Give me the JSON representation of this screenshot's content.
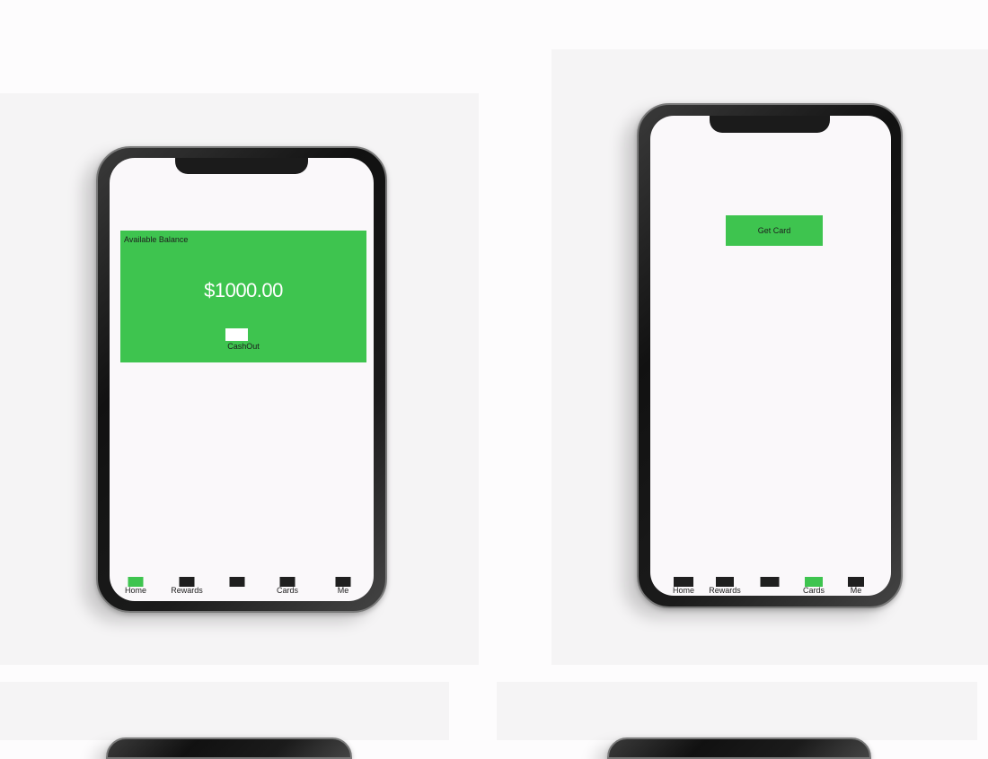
{
  "colors": {
    "accent_green": "#3ec44f",
    "nav_inactive": "#1f1f1f",
    "screen_bg": "#faf8fa"
  },
  "home_screen": {
    "balance_label": "Available Balance",
    "balance_amount": "$1000.00",
    "cashout_label": "CashOut",
    "nav": [
      {
        "label": "Home",
        "icon": "home-icon",
        "active": true
      },
      {
        "label": "Rewards",
        "icon": "rewards-icon",
        "active": false
      },
      {
        "label": "",
        "icon": "nav-icon",
        "active": false
      },
      {
        "label": "Cards",
        "icon": "cards-icon",
        "active": false
      },
      {
        "label": "Me",
        "icon": "profile-icon",
        "active": false
      }
    ]
  },
  "cards_screen": {
    "get_card_label": "Get Card",
    "nav": [
      {
        "label": "Home",
        "icon": "home-icon",
        "active": false
      },
      {
        "label": "Rewards",
        "icon": "rewards-icon",
        "active": false
      },
      {
        "label": "",
        "icon": "nav-icon",
        "active": false
      },
      {
        "label": "Cards",
        "icon": "cards-icon",
        "active": true
      },
      {
        "label": "Me",
        "icon": "profile-icon",
        "active": false
      }
    ]
  }
}
